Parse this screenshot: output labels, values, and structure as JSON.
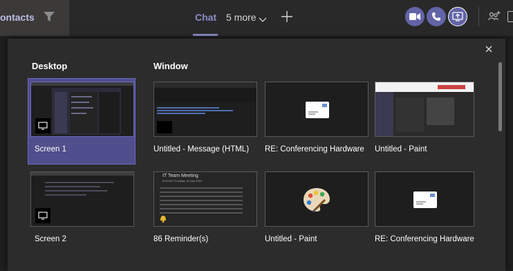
{
  "topbar": {
    "contacts_label": "ontacts",
    "chat_label": "Chat",
    "more_label": "5 more"
  },
  "panel": {
    "desktop_heading": "Desktop",
    "window_heading": "Window",
    "desktop_items": [
      {
        "label": "Screen 1"
      },
      {
        "label": "Screen 2"
      }
    ],
    "window_items": [
      {
        "label": "Untitled - Message (HTML)"
      },
      {
        "label": "RE: Conferencing Hardware"
      },
      {
        "label": "Untitled - Paint"
      },
      {
        "label": "86 Reminder(s)"
      },
      {
        "label": "Untitled - Paint"
      },
      {
        "label": "RE: Conferencing Hardware"
      }
    ],
    "reminder_preview": {
      "title": "IT Team Meeting",
      "subtitle": "8:00 AM Thursday, 18 July 2019"
    }
  },
  "colors": {
    "accent": "#6264a7",
    "selected_bg": "#504e8c",
    "panel_bg": "#2d2c2c"
  },
  "icons": [
    "filter-icon",
    "chevron-down-icon",
    "plus-icon",
    "video-call-icon",
    "audio-call-icon",
    "share-screen-icon",
    "add-people-icon",
    "close-icon",
    "monitor-icon",
    "mail-icon",
    "paint-palette-icon",
    "bell-icon"
  ]
}
